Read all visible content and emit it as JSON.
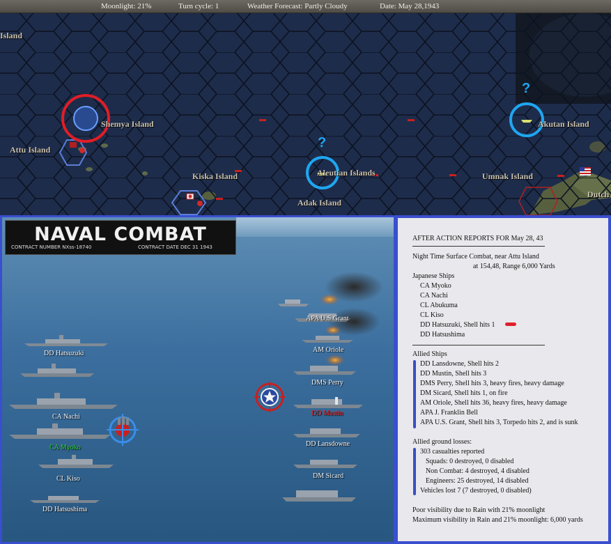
{
  "status_bar": {
    "moonlight": "Moonlight: 21%",
    "turn_cycle": "Turn cycle: 1",
    "weather": "Weather Forecast: Partly Cloudy",
    "date": "Date: May 28,1943"
  },
  "map": {
    "labels": [
      "Island",
      "Shemya Island",
      "Attu Island",
      "Kiska Island",
      "Aleutian Islands",
      "Adak Island",
      "Umnak Island",
      "Akutan Island",
      "Dutch"
    ],
    "question_marks": [
      "?",
      "?"
    ],
    "icons": [
      "japanese-flag-icon",
      "us-flag-icon",
      "ship-icon"
    ]
  },
  "combat": {
    "banner_title": "NAVAL COMBAT",
    "contract_number": "CONTRACT NUMBER   NXss-18740",
    "contract_date": "CONTRACT DATE  DEC 31 1943",
    "japanese_labels": [
      "DD Hatsuzuki",
      "CA Nachi",
      "CA Myoko",
      "CL Kiso",
      "DD Hatsushima"
    ],
    "allied_labels": [
      "APA U.S.Grant",
      "AM Oriole",
      "DMS Perry",
      "DD Mustin",
      "DD Lansdowne",
      "DM Sicard"
    ]
  },
  "report": {
    "title": "AFTER ACTION REPORTS FOR May 28, 43",
    "combat_line": "Night Time Surface Combat, near Attu Island",
    "location_line": "at 154,48, Range 6,000 Yards",
    "japanese_header": "Japanese Ships",
    "japanese_ships": [
      "CA Myoko",
      "CA Nachi",
      "CL Abukuma",
      "CL Kiso",
      "DD Hatsuzuki, Shell hits 1",
      "DD Hatsushima"
    ],
    "allied_header": "Allied Ships",
    "allied_ships": [
      "DD Lansdowne, Shell hits 2",
      "DD Mustin, Shell hits 3",
      "DMS Perry, Shell hits 3,  heavy fires,  heavy damage",
      "DM Sicard, Shell hits 1,  on fire",
      "AM Oriole, Shell hits 36,  heavy fires,  heavy damage",
      "APA J. Franklin Bell",
      "APA U.S. Grant, Shell hits 3, Torpedo hits 2, and is sunk"
    ],
    "ground_header": "Allied ground losses:",
    "ground_losses": [
      "303 casualties reported",
      "Squads: 0 destroyed, 0 disabled",
      "Non Combat: 4 destroyed, 4 disabled",
      "Engineers: 25 destroyed, 14 disabled",
      "Vehicles lost 7 (7 destroyed, 0 disabled)"
    ],
    "visibility_1": "Poor visibility due to Rain with 21% moonlight",
    "visibility_2": "Maximum visibility in Rain and 21% moonlight: 6,000 yards"
  },
  "colors": {
    "panel_border": "#3a4fd0",
    "highlight_red": "#e0202a",
    "highlight_blue": "#1fa6f0",
    "japanese_name_green": "#28d428",
    "sunk_name_red": "#e02828"
  }
}
